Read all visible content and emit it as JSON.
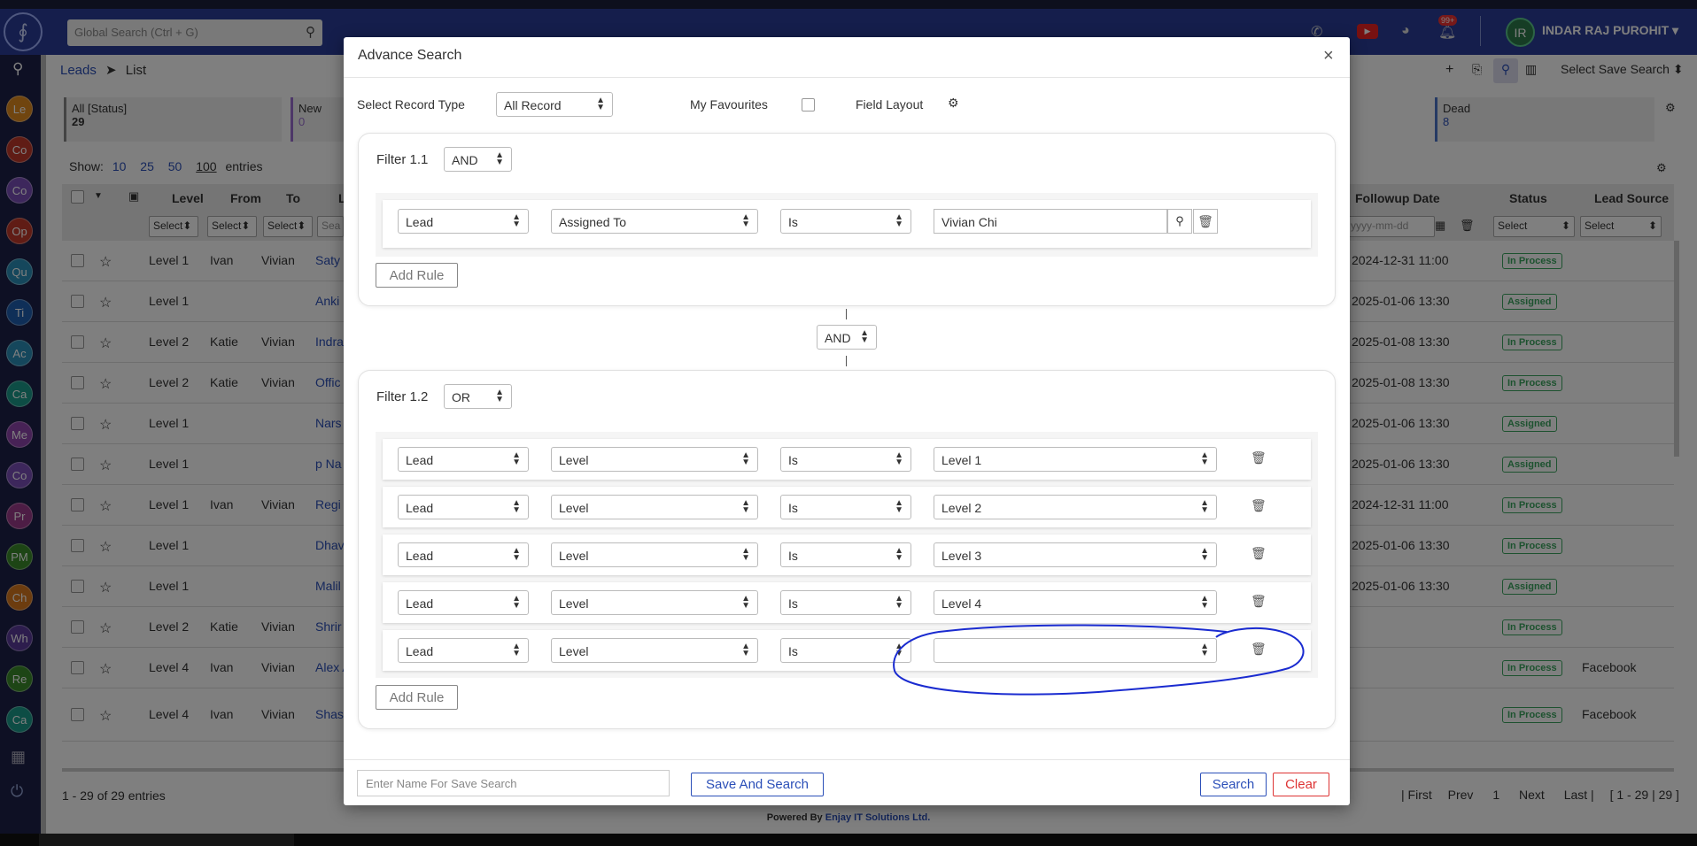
{
  "header": {
    "search_placeholder": "Global Search (Ctrl + G)",
    "notification_count": "99+",
    "avatar_initials": "IR",
    "user_name": "INDAR RAJ PUROHIT"
  },
  "sidebar": {
    "items": [
      "Le",
      "Co",
      "Co",
      "Op",
      "Qu",
      "Ti",
      "Ac",
      "Ca",
      "Me",
      "Co",
      "Pr",
      "PM",
      "Ch",
      "Wh",
      "Re",
      "Ca"
    ],
    "colors": [
      "#e08a1e",
      "#c0392b",
      "#7b4fb8",
      "#c0392b",
      "#2a8fb8",
      "#1f5fb0",
      "#2a8fb8",
      "#1a9a8a",
      "#8e44ad",
      "#7b4fb8",
      "#9b3a8a",
      "#3a8a2a",
      "#d9781e",
      "#5a3a9b",
      "#3a8a2a",
      "#1a9a8a"
    ]
  },
  "page": {
    "breadcrumb_root": "Leads",
    "breadcrumb_sep": "➤",
    "breadcrumb_current": "List",
    "save_search_label": "Select Save Search",
    "tiles": {
      "all_label": "All [Status]",
      "all_count": "29",
      "new_label": "New",
      "new_count": "0",
      "dead_label": "Dead",
      "dead_count": "8"
    },
    "show_label": "Show:",
    "page_sizes": [
      "10",
      "25",
      "50",
      "100"
    ],
    "entries_label": "entries",
    "columns": {
      "level": "Level",
      "from": "From",
      "to": "To",
      "l": "L",
      "followup": "Followup Date",
      "status": "Status",
      "source": "Lead Source"
    },
    "filter_select": "Select",
    "filter_search": "Sea",
    "date_placeholder": "yyyy-mm-dd",
    "rows": [
      {
        "level": "Level 1",
        "from": "Ivan",
        "to": "Vivian",
        "name": "Saty",
        "date": "2024-12-31 11:00",
        "status": "In Process",
        "source": ""
      },
      {
        "level": "Level 1",
        "from": "",
        "to": "",
        "name": "Anki",
        "date": "2025-01-06 13:30",
        "status": "Assigned",
        "source": ""
      },
      {
        "level": "Level 2",
        "from": "Katie",
        "to": "Vivian",
        "name": "Indra Bagr",
        "date": "2025-01-08 13:30",
        "status": "In Process",
        "source": ""
      },
      {
        "level": "Level 2",
        "from": "Katie",
        "to": "Vivian",
        "name": "Offic",
        "date": "2025-01-08 13:30",
        "status": "In Process",
        "source": ""
      },
      {
        "level": "Level 1",
        "from": "",
        "to": "",
        "name": "Nars",
        "date": "2025-01-06 13:30",
        "status": "Assigned",
        "source": ""
      },
      {
        "level": "Level 1",
        "from": "",
        "to": "",
        "name": "p Na",
        "date": "2025-01-06 13:30",
        "status": "Assigned",
        "source": ""
      },
      {
        "level": "Level 1",
        "from": "Ivan",
        "to": "Vivian",
        "name": "Regi",
        "date": "2024-12-31 11:00",
        "status": "In Process",
        "source": ""
      },
      {
        "level": "Level 1",
        "from": "",
        "to": "",
        "name": "Dhav",
        "date": "2025-01-06 13:30",
        "status": "In Process",
        "source": ""
      },
      {
        "level": "Level 1",
        "from": "",
        "to": "",
        "name": "Malil",
        "date": "2025-01-06 13:30",
        "status": "Assigned",
        "source": ""
      },
      {
        "level": "Level 2",
        "from": "Katie",
        "to": "Vivian",
        "name": "Shrir Sing",
        "date": "",
        "status": "In Process",
        "source": ""
      },
      {
        "level": "Level 4",
        "from": "Ivan",
        "to": "Vivian",
        "name": "Alex Alex",
        "date": "",
        "status": "In Process",
        "source": "Facebook"
      },
      {
        "level": "Level 4",
        "from": "Ivan",
        "to": "Vivian",
        "name": "Shas Sriva Shas Sriva",
        "date": "",
        "status": "In Process",
        "source": "Facebook"
      }
    ],
    "entries_summary": "1 - 29 of 29 entries",
    "pager": {
      "first": "| First",
      "prev": "Prev",
      "page": "1",
      "next": "Next",
      "last": "Last |",
      "range": "[ 1 - 29 | 29 ]"
    },
    "powered_prefix": "Powered By",
    "powered_company": "Enjay IT Solutions Ltd."
  },
  "modal": {
    "title": "Advance Search",
    "close": "×",
    "record_type_label": "Select Record Type",
    "record_type_value": "All Record",
    "favourites_label": "My Favourites",
    "field_layout_label": "Field Layout",
    "filter1": {
      "label": "Filter 1.1",
      "operator": "AND",
      "rule": {
        "module": "Lead",
        "field": "Assigned To",
        "op": "Is",
        "value": "Vivian Chi"
      },
      "add_rule": "Add Rule"
    },
    "join_operator": "AND",
    "filter2": {
      "label": "Filter 1.2",
      "operator": "OR",
      "rules": [
        {
          "module": "Lead",
          "field": "Level",
          "op": "Is",
          "value": "Level 1"
        },
        {
          "module": "Lead",
          "field": "Level",
          "op": "Is",
          "value": "Level 2"
        },
        {
          "module": "Lead",
          "field": "Level",
          "op": "Is",
          "value": "Level 3"
        },
        {
          "module": "Lead",
          "field": "Level",
          "op": "Is",
          "value": "Level 4"
        },
        {
          "module": "Lead",
          "field": "Level",
          "op": "Is",
          "value": ""
        }
      ],
      "add_rule": "Add Rule"
    },
    "save_name_placeholder": "Enter Name For Save Search",
    "save_and_search": "Save And Search",
    "search": "Search",
    "clear": "Clear"
  }
}
